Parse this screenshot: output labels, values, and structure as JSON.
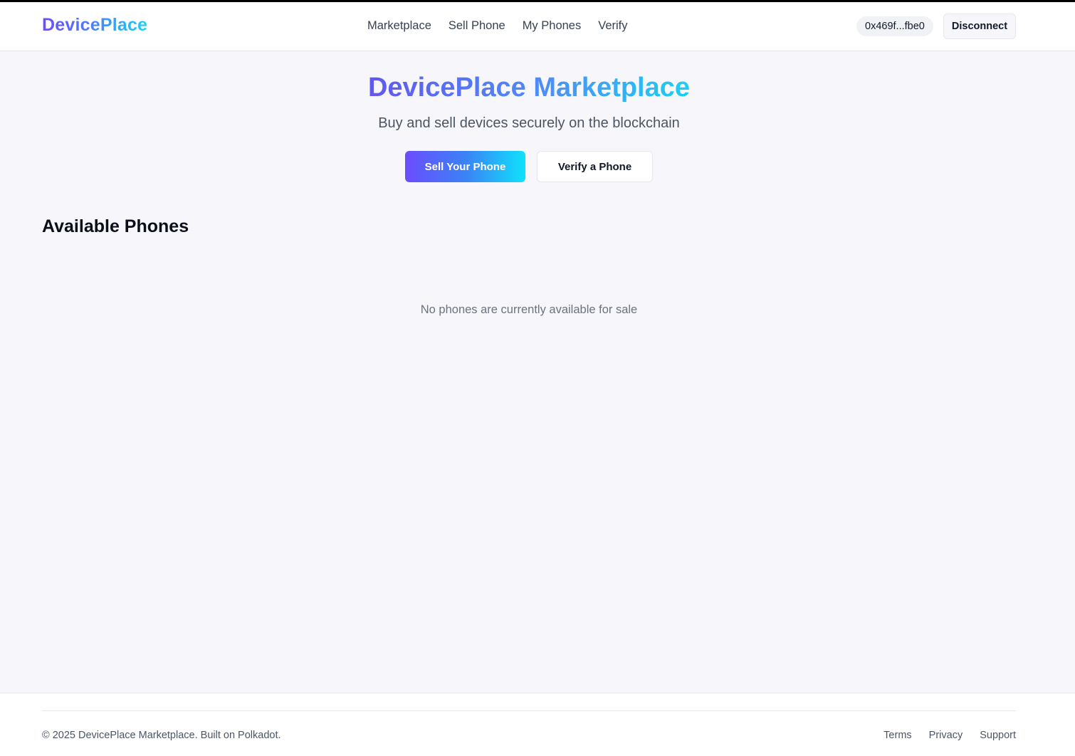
{
  "header": {
    "logo": "DevicePlace",
    "nav": [
      "Marketplace",
      "Sell Phone",
      "My Phones",
      "Verify"
    ],
    "wallet_address": "0x469f...fbe0",
    "disconnect_label": "Disconnect"
  },
  "hero": {
    "title": "DevicePlace Marketplace",
    "subtitle": "Buy and sell devices securely on the blockchain",
    "primary_button": "Sell Your Phone",
    "secondary_button": "Verify a Phone"
  },
  "listings": {
    "title": "Available Phones",
    "empty_message": "No phones are currently available for sale"
  },
  "footer": {
    "copyright": "© 2025 DevicePlace Marketplace. Built on Polkadot.",
    "links": [
      "Terms",
      "Privacy",
      "Support"
    ]
  },
  "colors": {
    "brand_gradient_start": "#6d4cff",
    "brand_gradient_end": "#19d3f5",
    "page_background": "#f7f7fb"
  }
}
